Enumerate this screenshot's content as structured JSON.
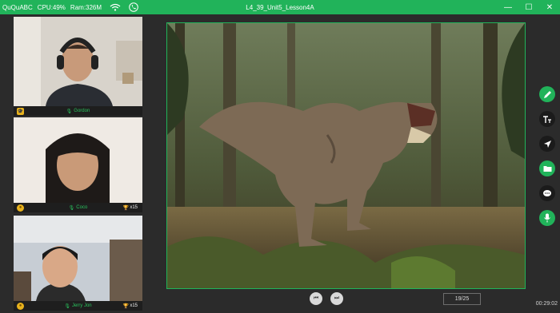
{
  "titlebar": {
    "app": "QuQuABC",
    "cpu": "CPU:49%",
    "ram": "Ram:326M",
    "title": "L4_39_Unit5_Lesson4A",
    "minimize": "—",
    "maximize": "☐",
    "close": "✕"
  },
  "participants": [
    {
      "name": "Gordon",
      "role": "teacher"
    },
    {
      "name": "Coco",
      "trophies": "x15"
    },
    {
      "name": "Jerry Jon",
      "trophies": "x15"
    }
  ],
  "slide": {
    "page": "19/25"
  },
  "timer": "00:29:02",
  "tools": [
    "pencil-icon",
    "text-size-icon",
    "pointer-icon",
    "folder-icon",
    "chat-icon",
    "mic-icon"
  ],
  "colors": {
    "accent": "#21b35a",
    "background": "#2b2b2b",
    "trophy": "#e8b21d"
  }
}
